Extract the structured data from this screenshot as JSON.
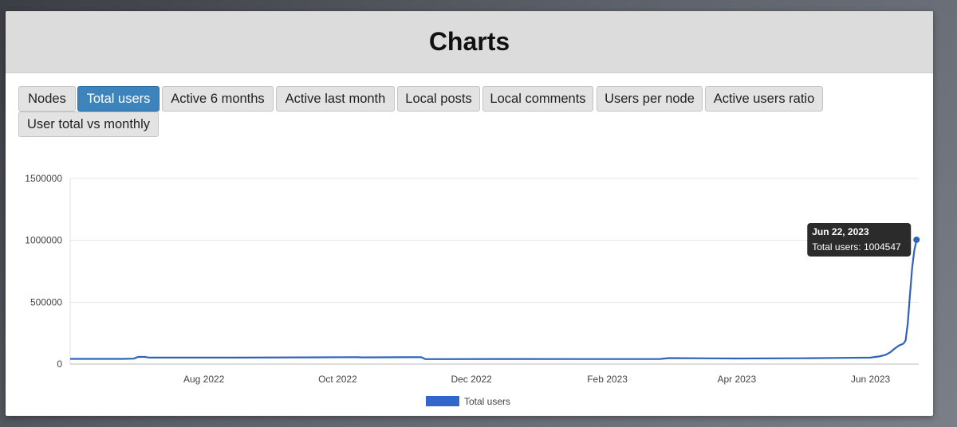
{
  "page": {
    "title": "Charts"
  },
  "tabs": [
    {
      "label": "Nodes",
      "active": false
    },
    {
      "label": "Total users",
      "active": true
    },
    {
      "label": "Active 6 months",
      "active": false
    },
    {
      "label": "Active last month",
      "active": false
    },
    {
      "label": "Local posts",
      "active": false
    },
    {
      "label": "Local comments",
      "active": false
    },
    {
      "label": "Users per node",
      "active": false
    },
    {
      "label": "Active users ratio",
      "active": false
    },
    {
      "label": "User total vs monthly",
      "active": false
    }
  ],
  "colors": {
    "accent": "#3d84bd",
    "series": "#2f63b8",
    "legend": "#3366cc",
    "tooltip_bg": "#2b2b2b"
  },
  "chart_data": {
    "type": "line",
    "ylim": [
      0,
      1500000
    ],
    "yticks": [
      0,
      500000,
      1000000,
      1500000
    ],
    "ytick_labels": [
      "0",
      "500000",
      "1000000",
      "1500000"
    ],
    "xlim": [
      "2022-06-01",
      "2023-06-23"
    ],
    "xticks": [
      "2022-08-01",
      "2022-10-01",
      "2022-12-01",
      "2023-02-01",
      "2023-04-01",
      "2023-06-01"
    ],
    "xtick_labels": [
      "Aug 2022",
      "Oct 2022",
      "Dec 2022",
      "Feb 2023",
      "Apr 2023",
      "Jun 2023"
    ],
    "grid": true,
    "legend": "bottom",
    "series": [
      {
        "name": "Total users",
        "points": [
          [
            "2022-06-01",
            42000
          ],
          [
            "2022-06-25",
            42000
          ],
          [
            "2022-06-30",
            44000
          ],
          [
            "2022-07-02",
            58000
          ],
          [
            "2022-07-05",
            58000
          ],
          [
            "2022-07-07",
            52000
          ],
          [
            "2022-08-15",
            52000
          ],
          [
            "2022-09-15",
            54000
          ],
          [
            "2022-10-10",
            56000
          ],
          [
            "2022-10-12",
            54000
          ],
          [
            "2022-11-08",
            56000
          ],
          [
            "2022-11-10",
            40000
          ],
          [
            "2022-12-15",
            41000
          ],
          [
            "2023-01-20",
            40500
          ],
          [
            "2023-02-25",
            41000
          ],
          [
            "2023-03-01",
            48000
          ],
          [
            "2023-04-01",
            45000
          ],
          [
            "2023-05-01",
            47000
          ],
          [
            "2023-05-20",
            50000
          ],
          [
            "2023-06-01",
            52000
          ],
          [
            "2023-06-05",
            62000
          ],
          [
            "2023-06-08",
            75000
          ],
          [
            "2023-06-10",
            95000
          ],
          [
            "2023-06-12",
            125000
          ],
          [
            "2023-06-14",
            150000
          ],
          [
            "2023-06-16",
            165000
          ],
          [
            "2023-06-17",
            190000
          ],
          [
            "2023-06-18",
            330000
          ],
          [
            "2023-06-19",
            560000
          ],
          [
            "2023-06-20",
            780000
          ],
          [
            "2023-06-21",
            920000
          ],
          [
            "2023-06-22",
            1004547
          ]
        ]
      }
    ],
    "tooltip": {
      "title": "Jun 22, 2023",
      "body": "Total users: 1004547"
    }
  }
}
